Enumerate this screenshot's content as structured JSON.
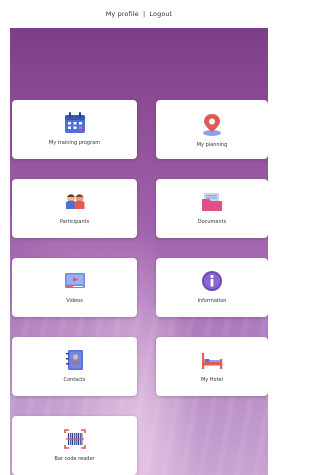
{
  "header": {
    "my_profile": "My profile",
    "separator": "|",
    "logout": "Logout"
  },
  "tiles": {
    "training": {
      "label": "My training program",
      "icon": "calendar-icon"
    },
    "planning": {
      "label": "My planning",
      "icon": "map-pin-icon"
    },
    "participants": {
      "label": "Participants",
      "icon": "people-icon"
    },
    "documents": {
      "label": "Documents",
      "icon": "folder-icon"
    },
    "videos": {
      "label": "Videos",
      "icon": "video-player-icon"
    },
    "information": {
      "label": "Information",
      "icon": "info-icon"
    },
    "contacts": {
      "label": "Contacts",
      "icon": "address-book-icon"
    },
    "hotel": {
      "label": "My Hotel",
      "icon": "bed-icon"
    },
    "barcode": {
      "label": "Bar code reader",
      "icon": "barcode-scanner-icon"
    }
  },
  "colors": {
    "accent": "#4e6fd8",
    "hero_top": "#7b3f86",
    "hero_bottom": "#c8a4d2",
    "pin": "#e05a57",
    "info": "#6a49b8"
  }
}
